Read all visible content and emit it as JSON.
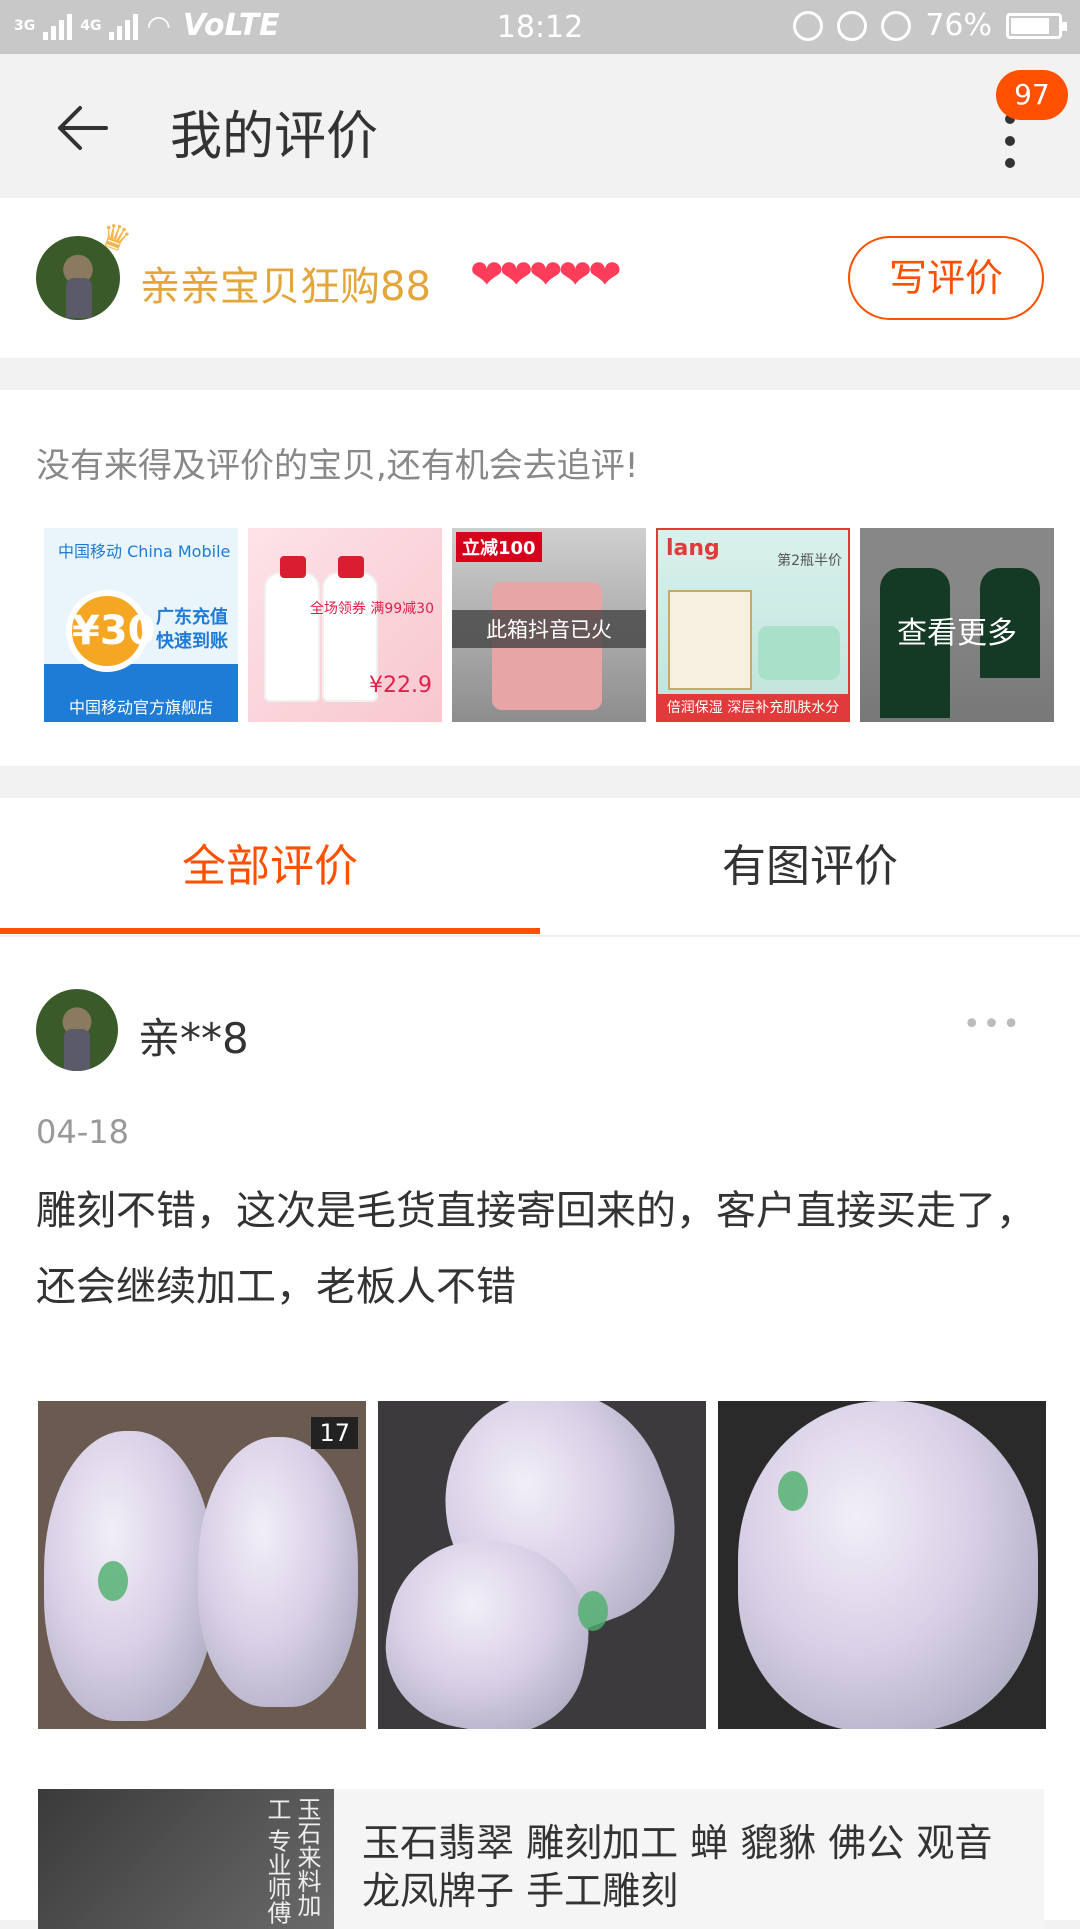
{
  "status_bar": {
    "network1": "3G",
    "network2": "4G",
    "volte": "VoLTE",
    "time": "18:12",
    "battery": "76%"
  },
  "nav": {
    "title": "我的评价",
    "badge_count": "97"
  },
  "user": {
    "name": "亲亲宝贝狂购88",
    "hearts": "❤❤❤❤❤",
    "write_review": "写评价"
  },
  "pending": {
    "tip": "没有来得及评价的宝贝,还有机会去追评!",
    "items": [
      {
        "logo": "中国移动 China Mobile",
        "coin": "¥30",
        "text": "广东充值 快速到账",
        "footer": "中国移动官方旗舰店"
      },
      {
        "promo": "全场领券 满99减30",
        "price": "¥22.9"
      },
      {
        "tag": "立减100",
        "caption": "此箱抖音已火"
      },
      {
        "brand": "lang",
        "half": "第2瓶半价",
        "footer": "倍润保湿 深层补充肌肤水分"
      },
      {
        "caption": "查看更多"
      }
    ]
  },
  "tabs": [
    {
      "label": "全部评价",
      "active": true
    },
    {
      "label": "有图评价",
      "active": false
    }
  ],
  "review": {
    "user": "亲**8",
    "more": "•••",
    "date": "04-18",
    "text": "雕刻不错，这次是毛货直接寄回来的，客户直接买走了，还会继续加工，老板人不错",
    "photo1_label": "17",
    "shop_image_text": "玉石来料加工 专业师傅",
    "shop_title": "玉石翡翠  雕刻加工 蝉 貔貅 佛公 观音 龙凤牌子 手工雕刻"
  },
  "colors": {
    "accent": "#ff5000",
    "username": "#e2a63a"
  }
}
